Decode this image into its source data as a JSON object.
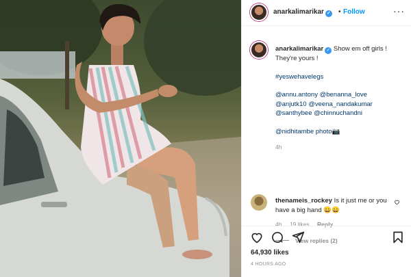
{
  "post": {
    "username": "anarkalimarikar",
    "verified_icon": "verified-badge-icon",
    "dot": "•",
    "follow_label": "Follow",
    "more_icon": "more-options-icon",
    "more_glyph": "···"
  },
  "caption": {
    "username": "anarkalimarikar",
    "text_line1": "Show em off girls !",
    "text_line2": "They're yours !",
    "hashtag": "#yeswehavelegs",
    "mentions_line1": "@annu.antony @benanna_love",
    "mentions_line2": "@anjutk10 @veena_nandakumar",
    "mentions_line3": "@santhybee @chinnuchandni",
    "credit": "@nidhitambe photo",
    "credit_emoji": "📷",
    "time": "4h"
  },
  "comment": {
    "username": "thenameis_rockey",
    "text": "Is it just me or you have a big hand 😄😄",
    "time": "4h",
    "likes": "19 likes",
    "reply_label": "Reply",
    "view_replies": "View replies (2)"
  },
  "footer": {
    "likes": "64,930 likes",
    "ago": "4 HOURS AGO"
  },
  "colors": {
    "link": "#00376b",
    "follow": "#0095f6",
    "muted": "#8e8e8e"
  }
}
